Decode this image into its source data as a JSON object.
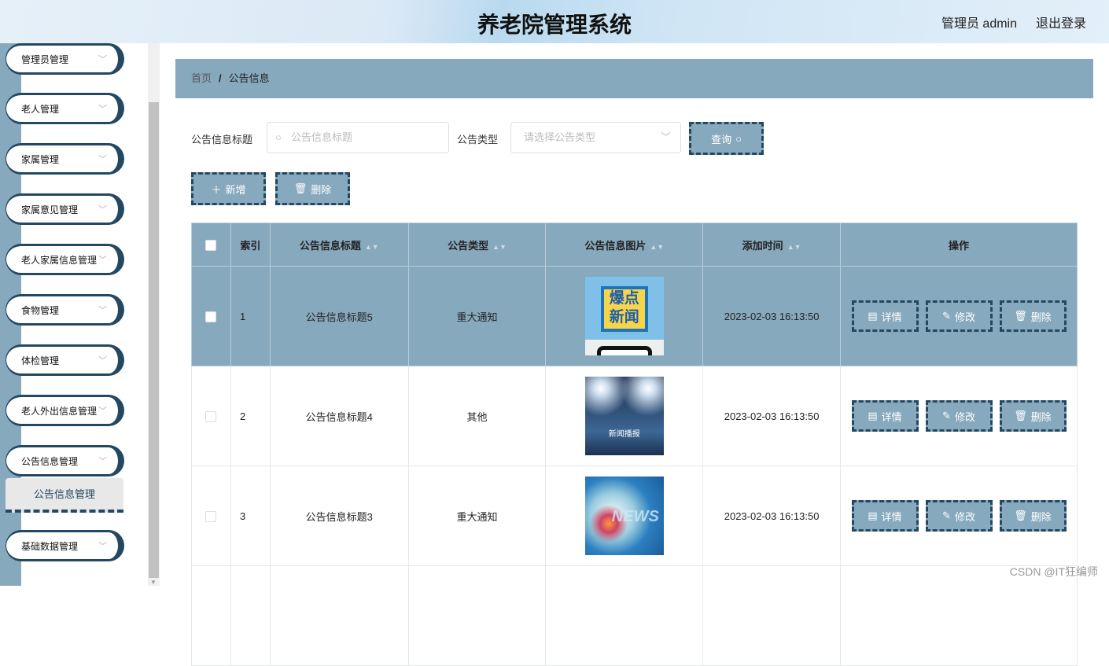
{
  "header": {
    "title": "养老院管理系统",
    "user": "管理员 admin",
    "logout": "退出登录"
  },
  "sidebar": {
    "items": [
      "管理员管理",
      "老人管理",
      "家属管理",
      "家属意见管理",
      "老人家属信息管理",
      "食物管理",
      "体检管理",
      "老人外出信息管理",
      "公告信息管理",
      "基础数据管理"
    ],
    "submenu": "公告信息管理"
  },
  "breadcrumb": {
    "home": "首页",
    "sep": "/",
    "current": "公告信息"
  },
  "search": {
    "title_label": "公告信息标题",
    "title_placeholder": "公告信息标题",
    "type_label": "公告类型",
    "type_placeholder": "请选择公告类型",
    "query": "查询"
  },
  "actions": {
    "add": "新增",
    "delete": "删除"
  },
  "table": {
    "headers": [
      "索引",
      "公告信息标题",
      "公告类型",
      "公告信息图片",
      "添加时间",
      "操作"
    ],
    "rows": [
      {
        "index": "1",
        "title": "公告信息标题5",
        "type": "重大通知",
        "img_text": "爆点新闻",
        "time": "2023-02-03 16:13:50"
      },
      {
        "index": "2",
        "title": "公告信息标题4",
        "type": "其他",
        "img_text": "新闻播报",
        "time": "2023-02-03 16:13:50"
      },
      {
        "index": "3",
        "title": "公告信息标题3",
        "type": "重大通知",
        "img_text": "NEWS",
        "time": "2023-02-03 16:13:50"
      }
    ],
    "ops": {
      "detail": "详情",
      "edit": "修改",
      "delete": "删除"
    }
  },
  "watermark": "CSDN @IT狂编师",
  "colors": {
    "accent": "#87a9bd",
    "dark": "#234862"
  }
}
